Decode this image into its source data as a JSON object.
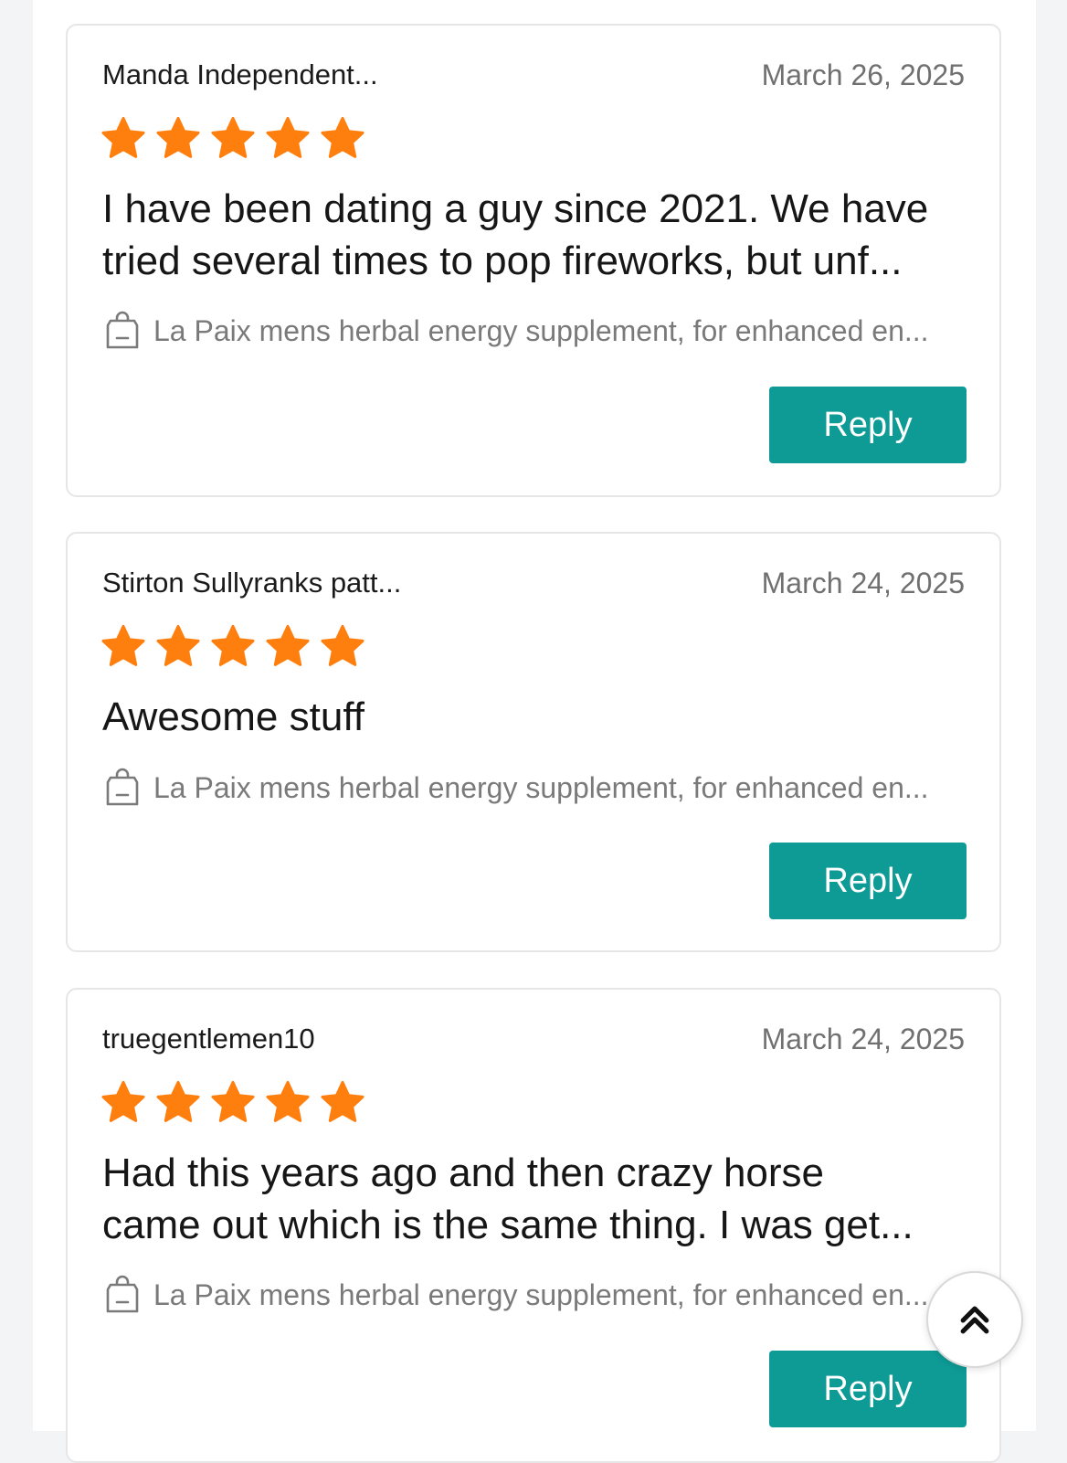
{
  "reviews": [
    {
      "reviewer": "Manda Independent...",
      "date": "March 26, 2025",
      "rating": 5,
      "text": "I have been dating a guy since 2021. We have\ntried several times to pop fireworks, but unf...",
      "product": "La Paix mens herbal energy supplement, for enhanced en...",
      "reply_label": "Reply"
    },
    {
      "reviewer": "Stirton Sullyranks patt...",
      "date": "March 24, 2025",
      "rating": 5,
      "text": "Awesome stuff",
      "product": "La Paix mens herbal energy supplement, for enhanced en...",
      "reply_label": "Reply"
    },
    {
      "reviewer": "truegentlemen10",
      "date": "March 24, 2025",
      "rating": 5,
      "text": "Had this years ago and then crazy horse\ncame out which is the same thing. I was get...",
      "product": "La Paix mens herbal energy supplement, for enhanced en...",
      "reply_label": "Reply"
    }
  ],
  "scroll_top": {
    "icon": "double-chevron-up-icon"
  },
  "colors": {
    "star": "#ff7f0e",
    "reply_button": "#0e9b96",
    "page_background": "#f3f4f6",
    "card_border": "#e6e6e6",
    "secondary_text": "#7a7a7a"
  }
}
